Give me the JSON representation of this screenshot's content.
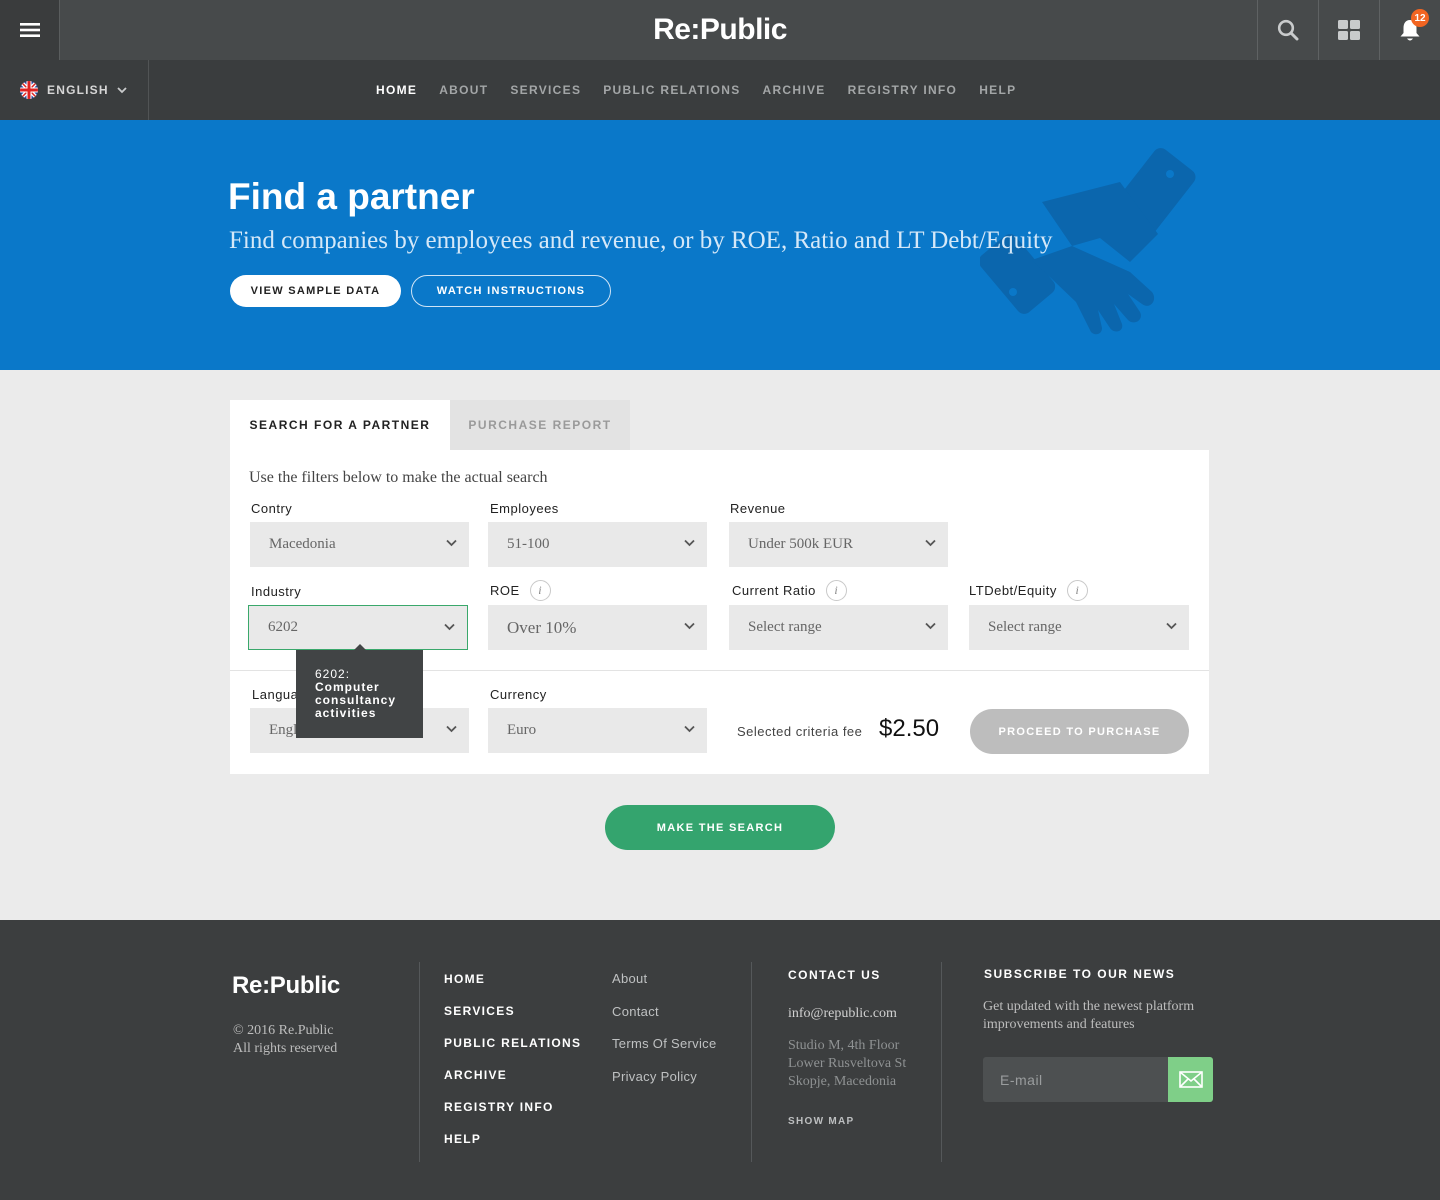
{
  "header": {
    "logo": "Re:Public",
    "notification_count": "12",
    "icons": [
      "menu-icon",
      "search-icon",
      "grid-icon",
      "bell-icon"
    ]
  },
  "language": {
    "label": "ENGLISH",
    "flag": "uk-flag-icon"
  },
  "nav": {
    "items": [
      "HOME",
      "ABOUT",
      "SERVICES",
      "PUBLIC RELATIONS",
      "ARCHIVE",
      "REGISTRY INFO",
      "HELP"
    ],
    "active": "HOME"
  },
  "hero": {
    "title": "Find a partner",
    "subtitle": "Find companies by employees and revenue, or by ROE, Ratio and LT Debt/Equity",
    "btn_sample": "VIEW SAMPLE DATA",
    "btn_instructions": "WATCH INSTRUCTIONS"
  },
  "tabs": {
    "search": "SEARCH FOR A PARTNER",
    "purchase": "PURCHASE REPORT"
  },
  "form": {
    "intro": "Use the filters below to make the actual search",
    "country": {
      "label": "Contry",
      "value": "Macedonia"
    },
    "employees": {
      "label": "Employees",
      "value": "51-100"
    },
    "revenue": {
      "label": "Revenue",
      "value": "Under 500k EUR"
    },
    "industry": {
      "label": "Industry",
      "value": "6202"
    },
    "roe": {
      "label": "ROE",
      "value": "Over 10%"
    },
    "current_ratio": {
      "label": "Current Ratio",
      "value": "Select range"
    },
    "ltdebt": {
      "label": "LTDebt/Equity",
      "value": "Select range"
    },
    "language": {
      "label": "Langua",
      "value": "Engl"
    },
    "currency": {
      "label": "Currency",
      "value": "Euro"
    },
    "info_glyph": "i",
    "fee_label": "Selected criteria fee",
    "fee_value": "$2.50",
    "proceed": "PROCEED TO PURCHASE"
  },
  "tooltip": {
    "code": "6202:",
    "text": "Computer consultancy activities"
  },
  "search_button": "MAKE THE SEARCH",
  "footer": {
    "logo": "Re:Public",
    "copyright": "© 2016 Re.Public",
    "rights": "All rights reserved",
    "nav": [
      "HOME",
      "SERVICES",
      "PUBLIC RELATIONS",
      "ARCHIVE",
      "REGISTRY INFO",
      "HELP"
    ],
    "links": [
      "About",
      "Contact",
      "Terms Of Service",
      "Privacy Policy"
    ],
    "contact_heading": "CONTACT US",
    "email": "info@republic.com",
    "address": [
      "Studio M, 4th Floor",
      "Lower Rusveltova St",
      "Skopje, Macedonia"
    ],
    "show_map": "SHOW MAP",
    "subscribe_heading": "SUBSCRIBE TO OUR NEWS",
    "subscribe_text": "Get updated with the newest platform improvements and features",
    "email_placeholder": "E-mail"
  },
  "colors": {
    "hero_blue": "#0a78c9",
    "accent_green": "#34a46e",
    "badge_orange": "#f26522",
    "dark_bg": "#3c3e3f"
  }
}
